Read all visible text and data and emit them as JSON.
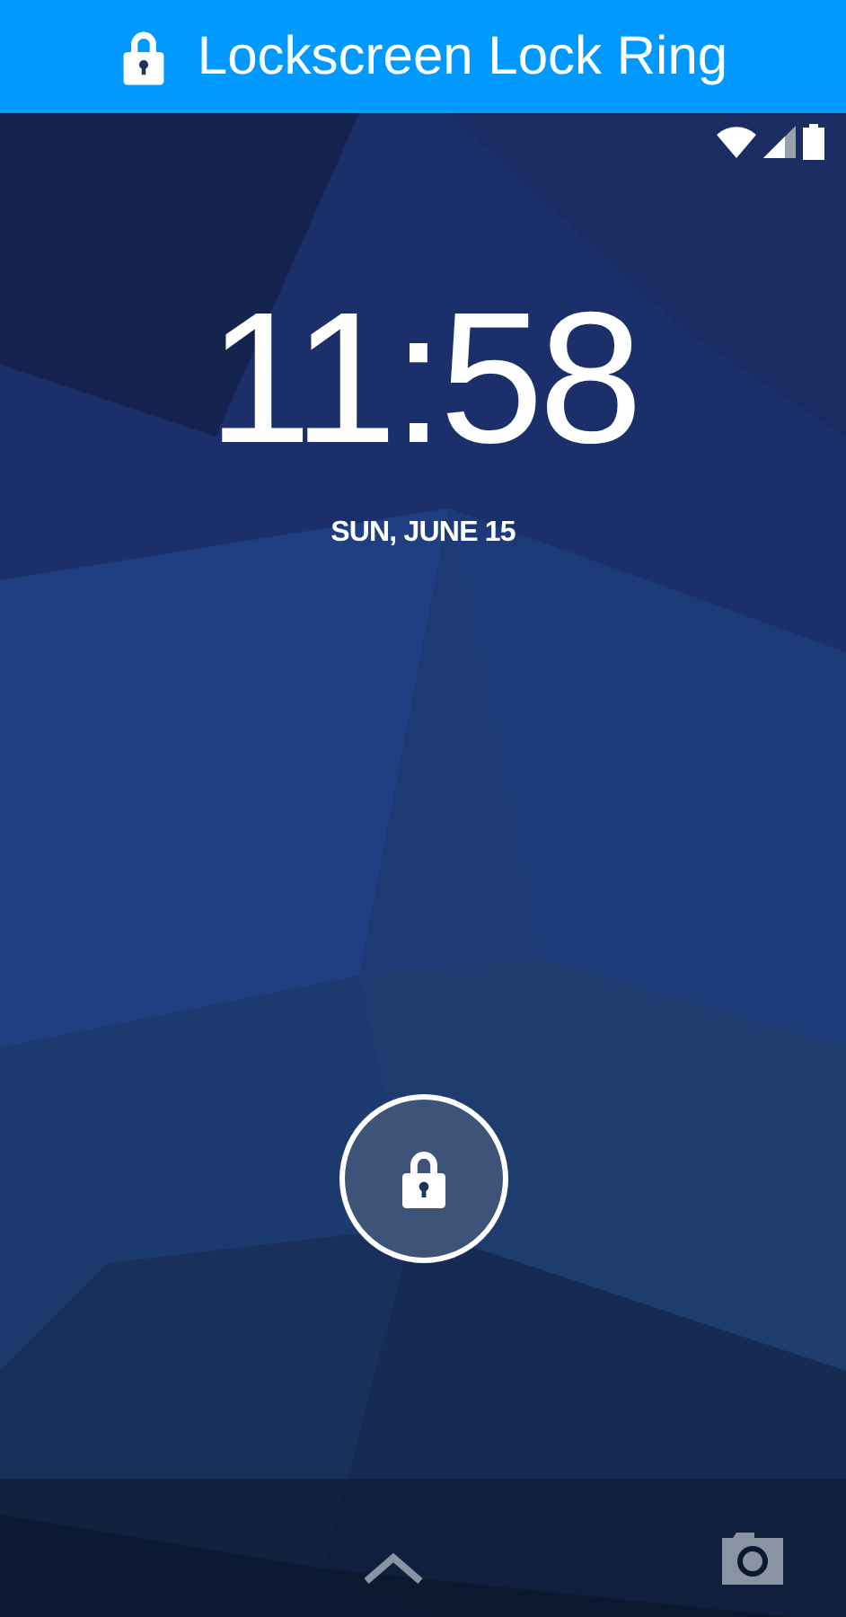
{
  "banner": {
    "title": "Lockscreen Lock Ring"
  },
  "lockscreen": {
    "time": "11:58",
    "date": "SUN, JUNE 15"
  }
}
